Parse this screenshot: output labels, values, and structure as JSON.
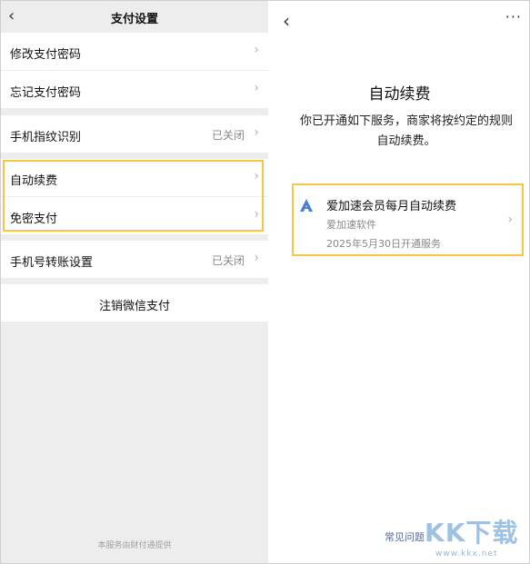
{
  "left": {
    "back_glyph": "‹",
    "title": "支付设置",
    "chevron_glyph": "›",
    "rows": {
      "change_password": "修改支付密码",
      "forgot_password": "忘记支付密码",
      "fingerprint": "手机指纹识别",
      "fingerprint_status": "已关闭",
      "auto_renew": "自动续费",
      "password_free": "免密支付",
      "phone_transfer": "手机号转账设置",
      "phone_transfer_status": "已关闭",
      "deregister": "注销微信支付"
    },
    "footer": "本服务由财付通提供"
  },
  "right": {
    "back_glyph": "‹",
    "more_glyph": "···",
    "title": "自动续费",
    "description": "你已开通如下服务，商家将按约定的规则自动续费。",
    "service": {
      "logo_color": "#4a7fd8",
      "name": "爱加速会员每月自动续费",
      "vendor": "爱加速软件",
      "opened": "2025年5月30日开通服务",
      "chevron_glyph": "›"
    },
    "faq": "常见问题",
    "watermark": "KK下载",
    "watermark_url": "www.kkx.net"
  },
  "colors": {
    "highlight": "#f4c842",
    "link": "#576b95",
    "page_bg": "#ededed"
  }
}
